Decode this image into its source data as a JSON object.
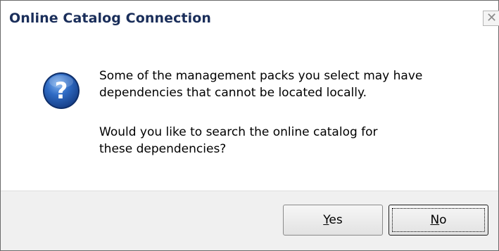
{
  "window": {
    "title": "Online Catalog Connection",
    "close_icon": "close-icon"
  },
  "message": {
    "icon": "question-icon",
    "line1": "Some of the management packs you select may have",
    "line2": "dependencies that cannot be located locally.",
    "line3": "Would you like to search the online catalog for",
    "line4": "these dependencies?"
  },
  "buttons": {
    "yes": {
      "mnemonic": "Y",
      "rest": "es"
    },
    "no": {
      "mnemonic": "N",
      "rest": "o"
    }
  },
  "colors": {
    "title": "#1a2e5a",
    "icon_blue": "#1f4f9e",
    "footer_bg": "#f0f0f0"
  }
}
